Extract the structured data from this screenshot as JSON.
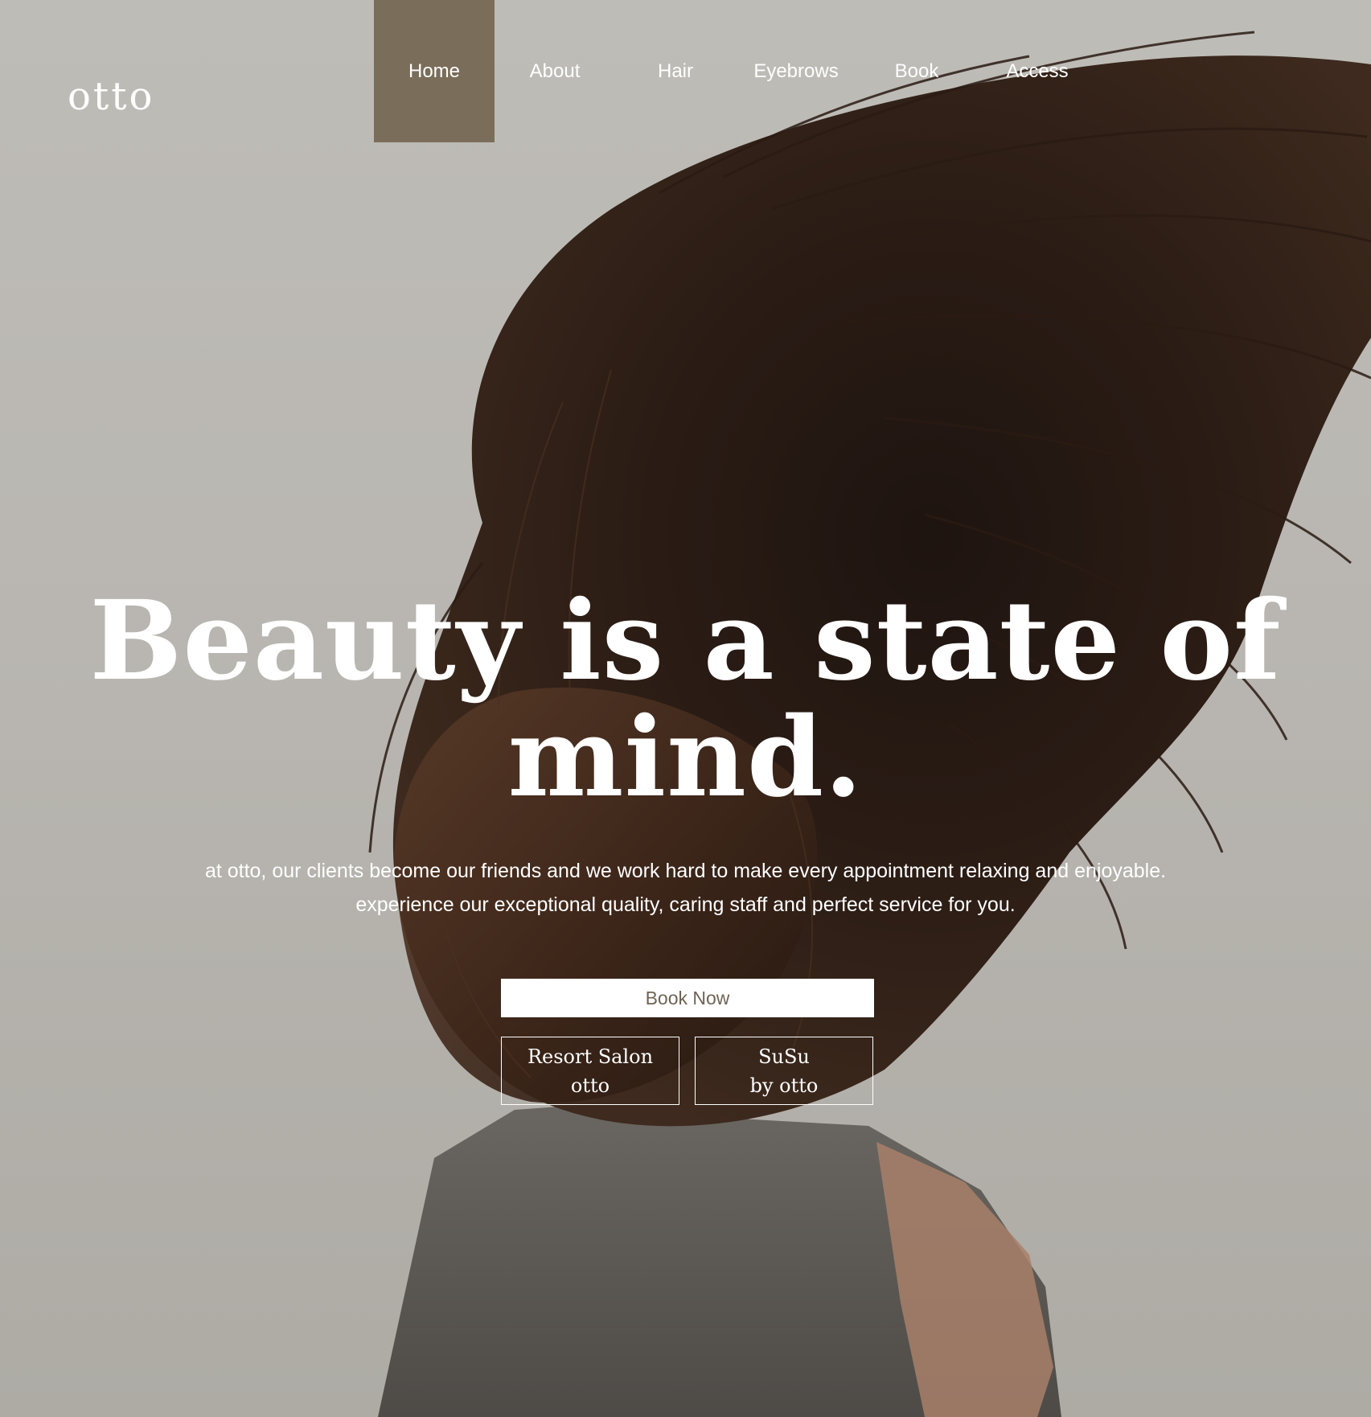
{
  "brand": {
    "logo": "otto"
  },
  "nav": {
    "items": [
      {
        "label": "Home",
        "active": true
      },
      {
        "label": "About",
        "active": false
      },
      {
        "label": "Hair",
        "active": false
      },
      {
        "label": "Eyebrows",
        "active": false
      },
      {
        "label": "Book",
        "active": false
      },
      {
        "label": "Access",
        "active": false
      }
    ]
  },
  "hero": {
    "headline_line1": "Beauty is a state of",
    "headline_line2": "mind.",
    "subtext_line1": "at otto, our clients become our friends and we work hard to make every appointment relaxing and enjoyable.",
    "subtext_line2": "experience our exceptional quality, caring staff and perfect service for you."
  },
  "buttons": {
    "book_now": "Book Now",
    "resort_line1": "Resort Salon",
    "resort_line2": "otto",
    "susu_line1": "SuSu",
    "susu_line2": "by otto"
  },
  "colors": {
    "nav_active": "#7a6d5a",
    "background": "#bcb9b4",
    "book_text": "#6e6454"
  }
}
